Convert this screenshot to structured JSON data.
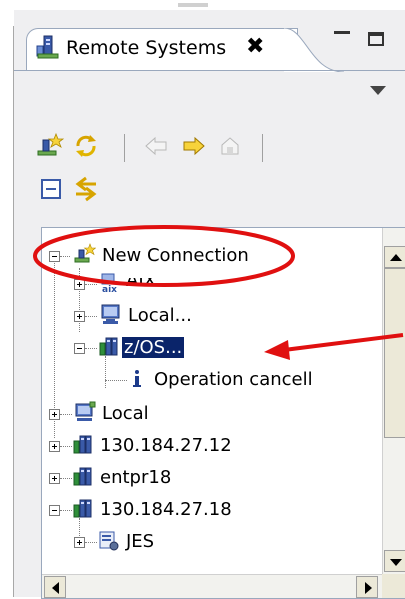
{
  "view": {
    "title": "Remote Systems",
    "close_glyph": "✖",
    "icons": {
      "tab": "remote-systems-icon",
      "minimize": "minimize-icon",
      "maximize": "maximize-icon",
      "view_menu": "view-menu-icon"
    }
  },
  "toolbar": {
    "items": [
      "new-connection-icon",
      "refresh-icon",
      "back-arrow-icon",
      "forward-arrow-icon",
      "home-icon"
    ],
    "items2": [
      "collapse-all-icon",
      "link-with-editor-icon"
    ]
  },
  "tree": {
    "rows": [
      {
        "label": "New Connection",
        "icon": "new-connection-icon",
        "expander": "minus"
      },
      {
        "label": "AIX...",
        "icon": "aix-icon",
        "expander": "plus"
      },
      {
        "label": "Local...",
        "icon": "monitor-icon",
        "expander": "plus"
      },
      {
        "label": "z/OS...",
        "icon": "zos-server-icon",
        "expander": "minus",
        "selected": true
      },
      {
        "label": "Operation cancell",
        "icon": "info-icon",
        "expander": "none"
      },
      {
        "label": "Local",
        "icon": "local-system-icon",
        "expander": "plus"
      },
      {
        "label": "130.184.27.12",
        "icon": "zos-server-icon",
        "expander": "plus"
      },
      {
        "label": "entpr18",
        "icon": "zos-server-icon",
        "expander": "plus"
      },
      {
        "label": "130.184.27.18",
        "icon": "zos-server-icon",
        "expander": "minus"
      },
      {
        "label": "JES",
        "icon": "jes-icon",
        "expander": "plus"
      }
    ]
  },
  "colors": {
    "selection": "#0a246a",
    "annotation": "#e01010",
    "view_background": "#efeff1"
  }
}
